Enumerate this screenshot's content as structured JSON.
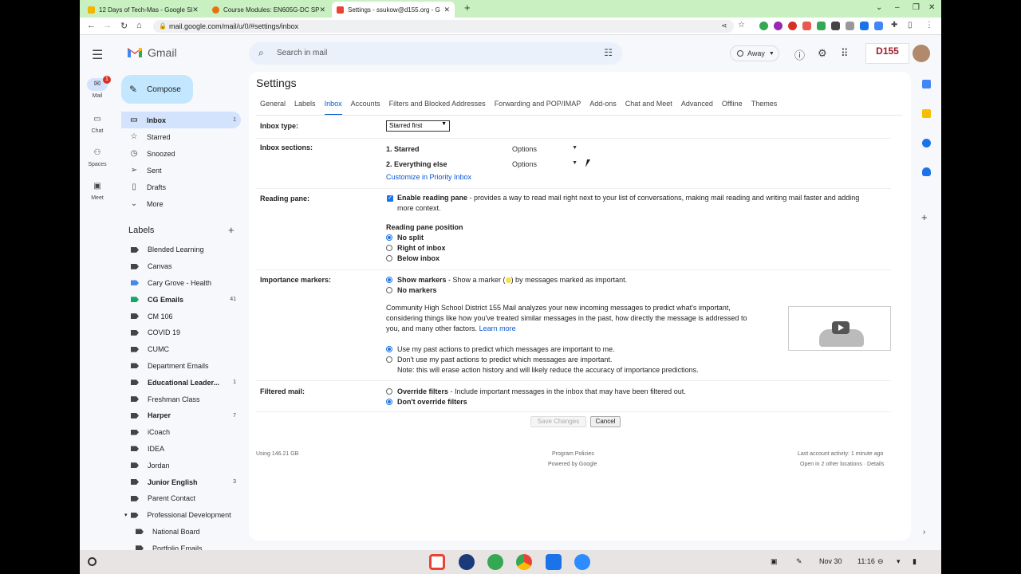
{
  "browser": {
    "tabs": [
      {
        "title": "12 Days of Tech-Mas - Google Sl",
        "color": "#f4b400"
      },
      {
        "title": "Course Modules: EN605G-DC SP",
        "color": "#e8710a"
      },
      {
        "title": "Settings - ssukow@d155.org - G",
        "color": "#ea4335"
      }
    ],
    "url": "mail.google.com/mail/u/0/#settings/inbox"
  },
  "header": {
    "app_name": "Gmail",
    "search_placeholder": "Search in mail",
    "status": "Away",
    "org_logo": "D155"
  },
  "rail": [
    {
      "label": "Mail",
      "icon": "mail-icon",
      "badge": "1"
    },
    {
      "label": "Chat",
      "icon": "chat-icon"
    },
    {
      "label": "Spaces",
      "icon": "spaces-icon"
    },
    {
      "label": "Meet",
      "icon": "meet-icon"
    }
  ],
  "compose_label": "Compose",
  "nav": [
    {
      "label": "Inbox",
      "icon": "inbox-icon",
      "count": "1",
      "selected": true
    },
    {
      "label": "Starred",
      "icon": "star-icon"
    },
    {
      "label": "Snoozed",
      "icon": "clock-icon"
    },
    {
      "label": "Sent",
      "icon": "send-icon"
    },
    {
      "label": "Drafts",
      "icon": "draft-icon"
    },
    {
      "label": "More",
      "icon": "chevron-down-icon"
    }
  ],
  "labels_heading": "Labels",
  "labels": [
    {
      "label": "Blended Learning"
    },
    {
      "label": "Canvas"
    },
    {
      "label": "Cary Grove - Health",
      "color": "#4a86e8"
    },
    {
      "label": "CG Emails",
      "count": "41",
      "bold": true,
      "color": "#16a765"
    },
    {
      "label": "CM 106"
    },
    {
      "label": "COVID 19"
    },
    {
      "label": "CUMC"
    },
    {
      "label": "Department Emails"
    },
    {
      "label": "Educational Leader...",
      "count": "1",
      "bold": true
    },
    {
      "label": "Freshman Class"
    },
    {
      "label": "Harper",
      "count": "7",
      "bold": true
    },
    {
      "label": "iCoach"
    },
    {
      "label": "IDEA"
    },
    {
      "label": "Jordan"
    },
    {
      "label": "Junior English",
      "count": "3",
      "bold": true
    },
    {
      "label": "Parent Contact"
    },
    {
      "label": "Professional Development"
    },
    {
      "label": "National Board"
    },
    {
      "label": "Portfolio Emails"
    }
  ],
  "settings": {
    "title": "Settings",
    "tabs": [
      "General",
      "Labels",
      "Inbox",
      "Accounts",
      "Filters and Blocked Addresses",
      "Forwarding and POP/IMAP",
      "Add-ons",
      "Chat and Meet",
      "Advanced",
      "Offline",
      "Themes"
    ],
    "inbox_type_label": "Inbox type:",
    "inbox_type_value": "Starred first",
    "inbox_sections_label": "Inbox sections:",
    "section1": "1. Starred",
    "section2": "2. Everything else",
    "options_label": "Options",
    "customize_link": "Customize in Priority Inbox",
    "reading_pane_label": "Reading pane:",
    "enable_reading_pane": "Enable reading pane",
    "reading_pane_desc_a": " - provides a way to read mail right next to your list of conversations, making mail reading and writing mail faster and adding",
    "reading_pane_desc_b": "more context.",
    "pane_position_heading": "Reading pane position",
    "pane_positions": [
      "No split",
      "Right of inbox",
      "Below inbox"
    ],
    "importance_label": "Importance markers:",
    "show_markers": "Show markers",
    "show_markers_desc_a": " - Show a marker (",
    "show_markers_desc_b": ") by messages marked as important.",
    "no_markers": "No markers",
    "importance_para_1": "Community High School District 155 Mail analyzes your new incoming messages to predict what's important,",
    "importance_para_2": "considering things like how you've treated similar messages in the past, how directly the message is addressed to",
    "importance_para_3": "you, and many other factors.",
    "learn_more": "Learn more",
    "use_past_actions": "Use my past actions to predict which messages are important to me.",
    "dont_use_past_actions": "Don't use my past actions to predict which messages are important.",
    "dont_use_note": "Note: this will erase action history and will likely reduce the accuracy of importance predictions.",
    "filtered_label": "Filtered mail:",
    "override_filters": "Override filters",
    "override_desc": " - Include important messages in the inbox that may have been filtered out.",
    "dont_override": "Don't override filters",
    "save_button": "Save Changes",
    "cancel_button": "Cancel"
  },
  "footer": {
    "storage": "Using 146.21 GB",
    "policies": "Program Policies",
    "powered": "Powered by Google",
    "activity": "Last account activity: 1 minute ago",
    "locations": "Open in 2 other locations · Details"
  },
  "shelf": {
    "date": "Nov 30",
    "time": "11:16"
  }
}
